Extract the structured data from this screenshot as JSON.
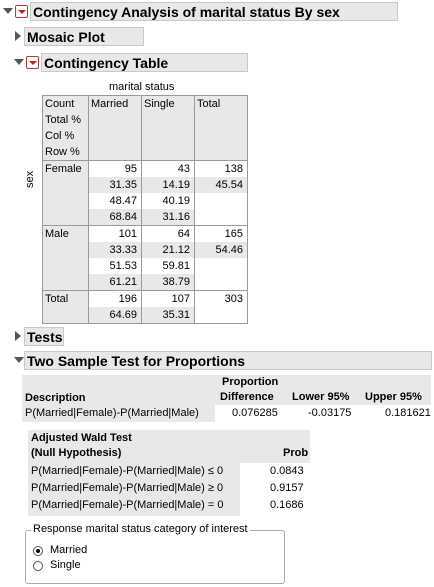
{
  "report": {
    "title": "Contingency Analysis of marital status By sex",
    "mosaic": "Mosaic Plot",
    "contingency": "Contingency Table",
    "tests": "Tests",
    "two_sample": "Two Sample Test for Proportions"
  },
  "contingency_table": {
    "col_var": "marital status",
    "row_var": "sex",
    "legend": [
      "Count",
      "Total %",
      "Col %",
      "Row %"
    ],
    "columns": [
      "Married",
      "Single",
      "Total"
    ],
    "rows": [
      {
        "label": "Female",
        "married": [
          "95",
          "31.35",
          "48.47",
          "68.84"
        ],
        "single": [
          "43",
          "14.19",
          "40.19",
          "31.16"
        ],
        "total": [
          "138",
          "45.54"
        ]
      },
      {
        "label": "Male",
        "married": [
          "101",
          "33.33",
          "51.53",
          "61.21"
        ],
        "single": [
          "64",
          "21.12",
          "59.81",
          "38.79"
        ],
        "total": [
          "165",
          "54.46"
        ]
      }
    ],
    "total_row": {
      "label": "Total",
      "married": [
        "196",
        "64.69"
      ],
      "single": [
        "107",
        "35.31"
      ],
      "total": "303"
    }
  },
  "two_sample_test": {
    "headers": {
      "description": "Description",
      "prop1": "Proportion",
      "prop2": "Difference",
      "lower": "Lower 95%",
      "upper": "Upper 95%"
    },
    "row": {
      "description": "P(Married|Female)-P(Married|Male)",
      "difference": "0.076285",
      "lower": "-0.03175",
      "upper": "0.181621"
    },
    "wald": {
      "title1": "Adjusted Wald Test",
      "title2": "(Null Hypothesis)",
      "prob_label": "Prob",
      "rows": [
        {
          "h": "P(Married|Female)-P(Married|Male) ≤ 0",
          "p": "0.0843"
        },
        {
          "h": "P(Married|Female)-P(Married|Male) ≥ 0",
          "p": "0.9157"
        },
        {
          "h": "P(Married|Female)-P(Married|Male) = 0",
          "p": "0.1686"
        }
      ]
    },
    "response": {
      "legend": "Response marital status category of interest",
      "options": [
        "Married",
        "Single"
      ],
      "selected": "Married"
    }
  }
}
